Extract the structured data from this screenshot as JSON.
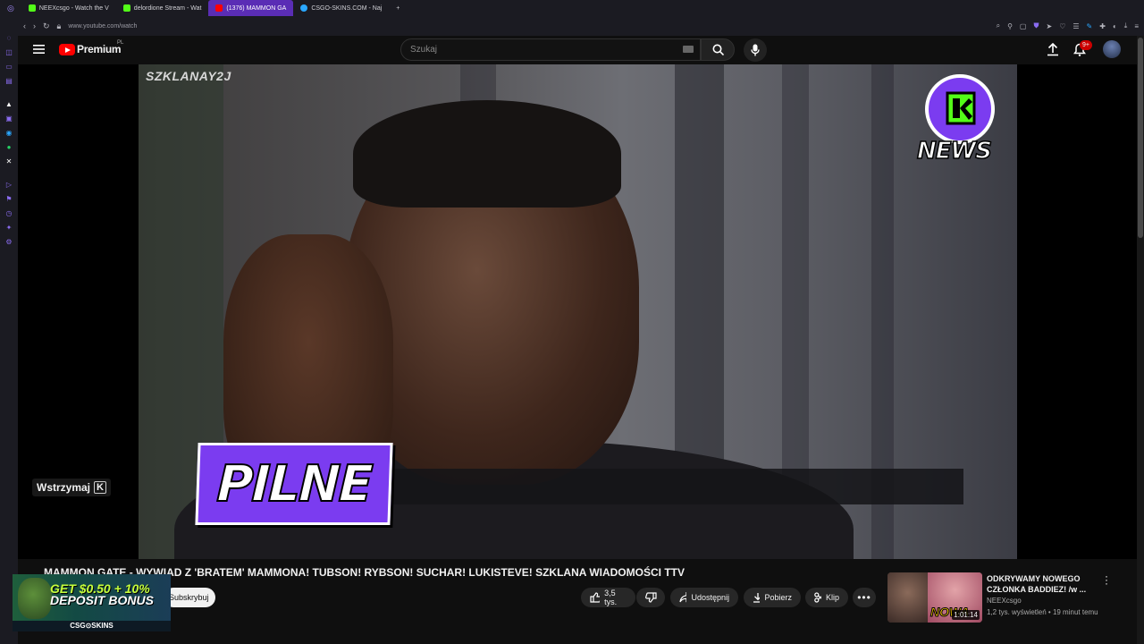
{
  "browser": {
    "tabs": [
      {
        "label": "NEEXcsgo - Watch the V",
        "favicon_color": "#53fc18"
      },
      {
        "label": "delordione Stream - Wat",
        "favicon_color": "#53fc18"
      },
      {
        "label": "(1376) MAMMON GA",
        "favicon_color": "#ff0000",
        "active": true
      },
      {
        "label": "CSGO-SKINS.COM - Naj",
        "favicon_color": "#2aa7ff"
      }
    ],
    "new_tab": "+",
    "url": "www.youtube.com/watch"
  },
  "youtube": {
    "logo_text": "Premium",
    "logo_region": "PL",
    "search_placeholder": "Szukaj",
    "notification_badge": "9+"
  },
  "video": {
    "watermark": "SZKLANAY2J",
    "badge_text": "NEWS",
    "overlay_text": "PILNE",
    "pause_tooltip": "Wstrzymaj",
    "pause_key": "K",
    "title": "MAMMON GATE - WYWIAD Z 'BRATEM' MAMMONA! TUBSON! RYBSON! SUCHAR! LUKISTEVE! SZKLANA WIADOMOŚCI TTV",
    "subscribe_label": "Subskrybuj",
    "likes": "3,5 tys.",
    "share_label": "Udostępnij",
    "download_label": "Pobierz",
    "clip_label": "Klip"
  },
  "ad": {
    "line1": "GET $0.50 + 10%",
    "line2": "DEPOSIT BONUS",
    "brand": "CSG⊙SKINS"
  },
  "recommendation": {
    "title": "ODKRYWAMY NOWEGO CZŁONKA BADDIEZ! /w ...",
    "channel": "NEEXcsgo",
    "meta": "1,2 tys. wyświetleń • 19 minut temu",
    "duration": "1:01:14",
    "thumb_text": "NOWA"
  }
}
